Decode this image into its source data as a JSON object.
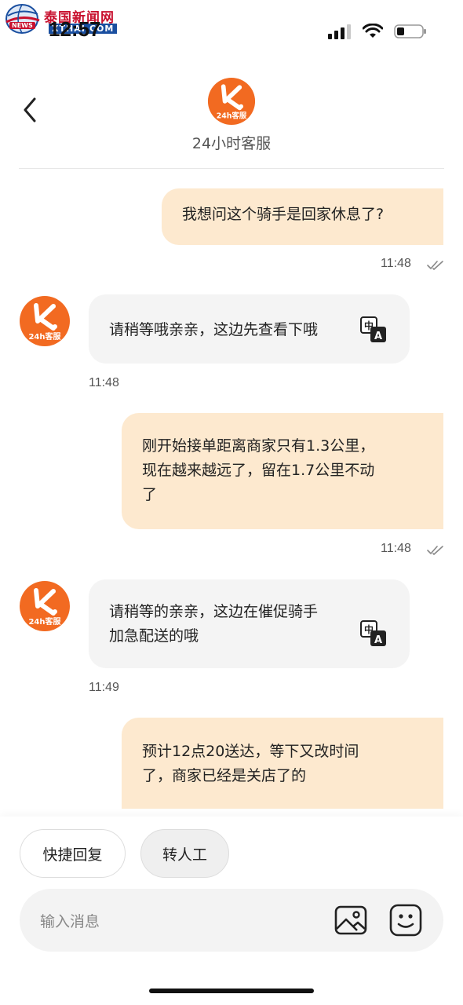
{
  "watermark": {
    "brand": "泰国新闻网",
    "site": "XTHAI.COM",
    "news": "NEWS"
  },
  "status_bar": {
    "time": "12:57"
  },
  "header": {
    "avatar_text": "24h客服",
    "title": "24小时客服"
  },
  "messages": [
    {
      "sender": "user",
      "lines": [
        "我想问这个骑手是回家休息了?"
      ],
      "time": "11:48",
      "read": true
    },
    {
      "sender": "agent",
      "avatar_text": "24h客服",
      "lines": [
        "请稍等哦亲亲，这边先查看下哦"
      ],
      "time": "11:48"
    },
    {
      "sender": "user",
      "lines": [
        "刚开始接单距离商家只有1.3公里，",
        "现在越来越远了，留在1.7公里不动",
        "了"
      ],
      "time": "11:48",
      "read": true
    },
    {
      "sender": "agent",
      "avatar_text": "24h客服",
      "lines": [
        "请稍等的亲亲，这边在催促骑手",
        "加急配送的哦"
      ],
      "time": "11:49"
    },
    {
      "sender": "user",
      "lines": [
        "预计12点20送达，等下又改时间",
        "了，商家已经是关店了的"
      ]
    }
  ],
  "translate_icon": {
    "source": "中",
    "target": "A"
  },
  "quick_replies": [
    "快捷回复",
    "转人工"
  ],
  "input": {
    "placeholder": "输入消息"
  },
  "colors": {
    "brand_orange": "#f26a21",
    "user_bubble": "#fde9cf",
    "agent_bubble": "#f4f4f4"
  }
}
